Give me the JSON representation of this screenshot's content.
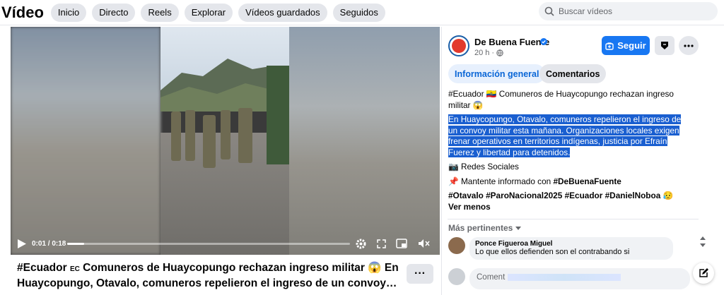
{
  "header": {
    "title": "Vídeo",
    "nav": [
      "Inicio",
      "Directo",
      "Reels",
      "Explorar",
      "Vídeos guardados",
      "Seguidos"
    ],
    "search_placeholder": "Buscar vídeos"
  },
  "player": {
    "time": "0:01 / 0:18",
    "progress_fraction": 0.06
  },
  "caption": {
    "part1": "#Ecuador",
    "flag_code": "EC",
    "part2": "Comuneros de Huaycopungo rechazan ingreso militar 😱 En Huaycopungo, Otavalo, comuneros repelieron el ingreso de un convoy…",
    "more": "···"
  },
  "page": {
    "name": "De Buena Fuente",
    "time": "20 h",
    "follow_label": "Seguir"
  },
  "tabs": [
    "Información general",
    "Comentarios"
  ],
  "post": {
    "line1": "#Ecuador 🇪🇨 Comuneros de Huaycopungo rechazan ingreso militar 😱",
    "highlighted": "En Huaycopungo, Otavalo, comuneros repelieron el ingreso de un convoy militar esta mañana. Organizaciones locales exigen frenar operativos en territorios indígenas, justicia por Efraín Fuerez y libertad para detenidos.",
    "social": "📷 Redes Sociales",
    "informed_prefix": "📌 Mantente informado con ",
    "informed_tag": "#DeBuenaFuente",
    "tags": "#Otavalo #ParoNacional2025 #Ecuador #DanielNoboa 😥",
    "see_less": "Ver menos"
  },
  "comments": {
    "sort_label": "Más pertinentes",
    "items": [
      {
        "author": "Ponce Figueroa Miguel",
        "text": "Lo que ellos defienden son el contrabando si"
      }
    ],
    "compose_placeholder": "Coment"
  }
}
